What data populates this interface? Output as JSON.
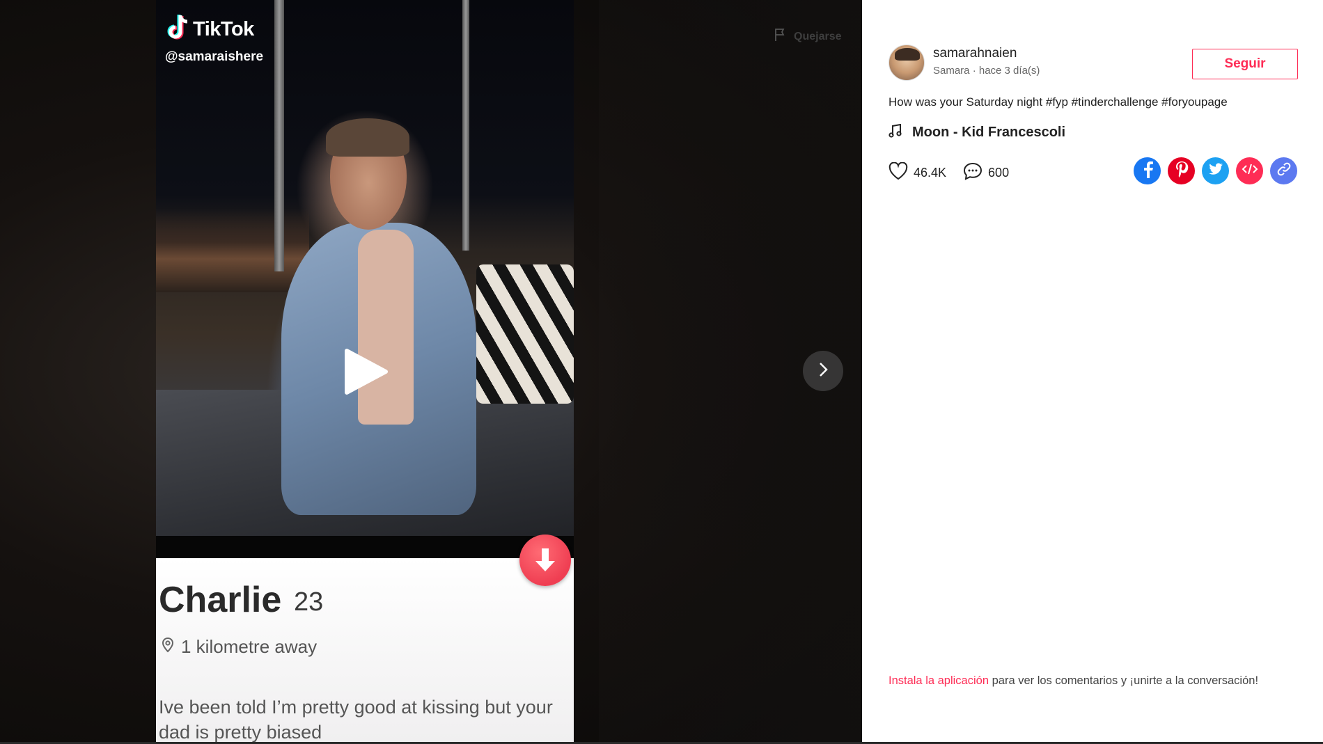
{
  "video": {
    "watermark": {
      "brand": "TikTok",
      "handle": "@samaraishere"
    },
    "report_label": "Quejarse",
    "profile_card": {
      "name": "Charlie",
      "age": "23",
      "distance": "1 kilometre away",
      "bio": "Ive been told I’m pretty good at kissing but your dad is pretty biased"
    },
    "icons": {
      "play": "play-icon",
      "next": "chevron-right-icon",
      "down": "arrow-down-icon",
      "flag": "flag-icon",
      "location": "location-pin-icon"
    }
  },
  "post": {
    "username": "samarahnaien",
    "meta": "Samara · hace 3 día(s)",
    "follow_label": "Seguir",
    "caption": "How was your Saturday night #fyp #tinderchallenge #foryoupage",
    "music": "Moon - Kid Francescoli",
    "likes": "46.4K",
    "comments": "600",
    "share": [
      {
        "name": "facebook-icon",
        "color": "#1877f2"
      },
      {
        "name": "pinterest-icon",
        "color": "#e60023"
      },
      {
        "name": "twitter-icon",
        "color": "#1da1f2"
      },
      {
        "name": "embed-icon",
        "color": "#fe2c55"
      },
      {
        "name": "link-icon",
        "color": "#5c79f0"
      }
    ],
    "install": {
      "link_text": "Instala la aplicación",
      "rest_text": " para ver los comentarios y ¡unirte a la conversación!"
    }
  },
  "colors": {
    "accent": "#fe2c55",
    "text": "#222222"
  }
}
